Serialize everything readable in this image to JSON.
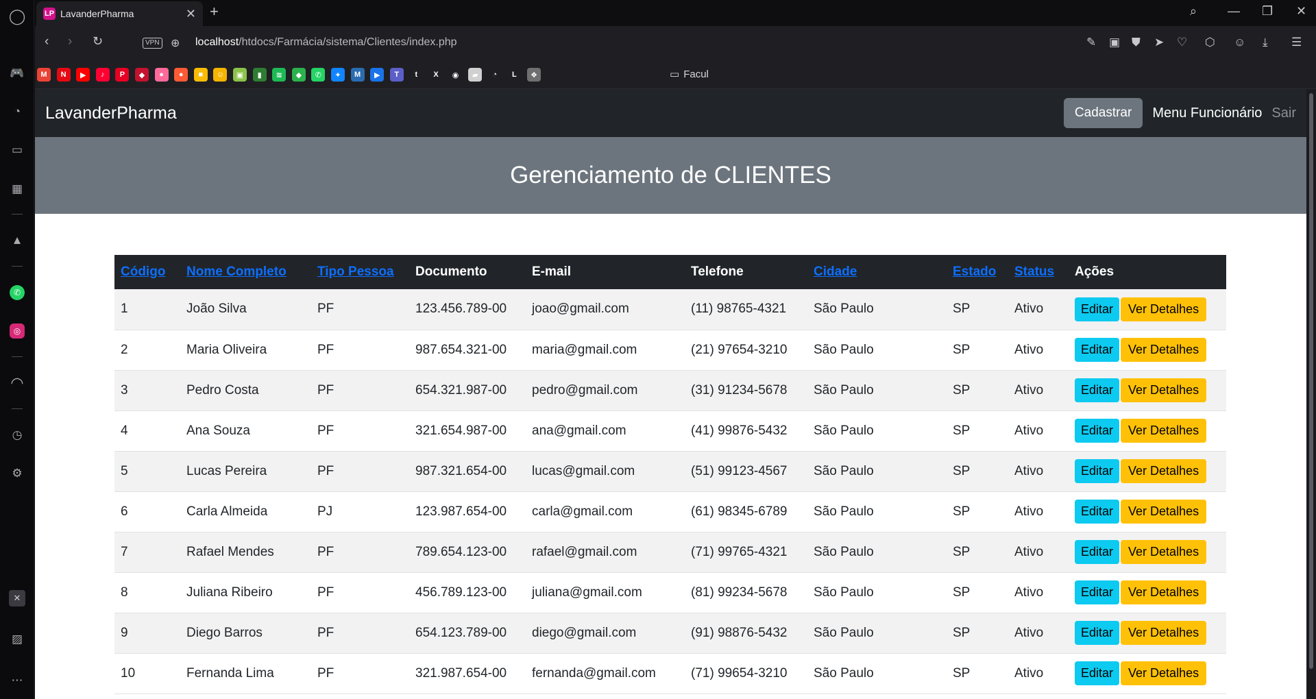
{
  "browser": {
    "tab_title": "LavanderPharma",
    "tab_favicon": "LP",
    "new_tab": "+",
    "vpn_label": "VPN",
    "url_host": "localhost",
    "url_path": "/htdocs/Farmácia/sistema/Clientes/index.php",
    "bookmark_folder": "Facul",
    "bookmarks": [
      {
        "icon": "gmail-icon",
        "glyph": "M",
        "color": "#ea4335"
      },
      {
        "icon": "netflix-icon",
        "glyph": "N",
        "color": "#e50914"
      },
      {
        "icon": "youtube-icon",
        "glyph": "▶",
        "color": "#ff0000"
      },
      {
        "icon": "youtube-music-icon",
        "glyph": "♪",
        "color": "#ff0033"
      },
      {
        "icon": "pinterest-icon",
        "glyph": "P",
        "color": "#e60023"
      },
      {
        "icon": "app-icon",
        "glyph": "◆",
        "color": "#c4122f"
      },
      {
        "icon": "app-icon",
        "glyph": "●",
        "color": "#ff6a9a"
      },
      {
        "icon": "app-icon",
        "glyph": "●",
        "color": "#ff5a36"
      },
      {
        "icon": "keep-icon",
        "glyph": "■",
        "color": "#fbbc04"
      },
      {
        "icon": "app-icon",
        "glyph": "☺",
        "color": "#f4b400"
      },
      {
        "icon": "app-icon",
        "glyph": "▣",
        "color": "#8bc34a"
      },
      {
        "icon": "app-icon",
        "glyph": "▮",
        "color": "#2e7d32"
      },
      {
        "icon": "spotify-icon",
        "glyph": "≋",
        "color": "#1db954"
      },
      {
        "icon": "feedly-icon",
        "glyph": "◆",
        "color": "#2bb24c"
      },
      {
        "icon": "whatsapp-icon",
        "glyph": "✆",
        "color": "#25d366"
      },
      {
        "icon": "bluesky-icon",
        "glyph": "✦",
        "color": "#1185fe"
      },
      {
        "icon": "app-icon",
        "glyph": "M",
        "color": "#2b6cb0"
      },
      {
        "icon": "app-icon",
        "glyph": "▶",
        "color": "#1a73e8"
      },
      {
        "icon": "teams-icon",
        "glyph": "T",
        "color": "#5b5fc7"
      },
      {
        "icon": "tumblr-icon",
        "glyph": "t",
        "color": "#1f1f23"
      },
      {
        "icon": "x-icon",
        "glyph": "X",
        "color": "#1f1f23"
      },
      {
        "icon": "github-icon",
        "glyph": "◉",
        "color": "#1f1f23"
      },
      {
        "icon": "app-icon",
        "glyph": "▰",
        "color": "#d0d0d0"
      },
      {
        "icon": "speedtest-icon",
        "glyph": "◔",
        "color": "#1f1f23"
      },
      {
        "icon": "app-icon",
        "glyph": "L",
        "color": "#1f1f23"
      },
      {
        "icon": "app-icon",
        "glyph": "❖",
        "color": "#6f6f6f"
      }
    ]
  },
  "page": {
    "brand": "LavanderPharma",
    "nav": {
      "cadastrar": "Cadastrar",
      "menu_funcionario": "Menu Funcionário",
      "sair": "Sair"
    },
    "title": "Gerenciamento de CLIENTES"
  },
  "table": {
    "headers": [
      "Código",
      "Nome Completo",
      "Tipo Pessoa",
      "Documento",
      "E-mail",
      "Telefone",
      "Cidade",
      "Estado",
      "Status",
      "Ações"
    ],
    "edit_label": "Editar",
    "details_label": "Ver Detalhes",
    "rows": [
      [
        "1",
        "João Silva",
        "PF",
        "123.456.789-00",
        "joao@gmail.com",
        "(11) 98765-4321",
        "São Paulo",
        "SP",
        "Ativo"
      ],
      [
        "2",
        "Maria Oliveira",
        "PF",
        "987.654.321-00",
        "maria@gmail.com",
        "(21) 97654-3210",
        "São Paulo",
        "SP",
        "Ativo"
      ],
      [
        "3",
        "Pedro Costa",
        "PF",
        "654.321.987-00",
        "pedro@gmail.com",
        "(31) 91234-5678",
        "São Paulo",
        "SP",
        "Ativo"
      ],
      [
        "4",
        "Ana Souza",
        "PF",
        "321.654.987-00",
        "ana@gmail.com",
        "(41) 99876-5432",
        "São Paulo",
        "SP",
        "Ativo"
      ],
      [
        "5",
        "Lucas Pereira",
        "PF",
        "987.321.654-00",
        "lucas@gmail.com",
        "(51) 99123-4567",
        "São Paulo",
        "SP",
        "Ativo"
      ],
      [
        "6",
        "Carla Almeida",
        "PJ",
        "123.987.654-00",
        "carla@gmail.com",
        "(61) 98345-6789",
        "São Paulo",
        "SP",
        "Ativo"
      ],
      [
        "7",
        "Rafael Mendes",
        "PF",
        "789.654.123-00",
        "rafael@gmail.com",
        "(71) 99765-4321",
        "São Paulo",
        "SP",
        "Ativo"
      ],
      [
        "8",
        "Juliana Ribeiro",
        "PF",
        "456.789.123-00",
        "juliana@gmail.com",
        "(81) 99234-5678",
        "São Paulo",
        "SP",
        "Ativo"
      ],
      [
        "9",
        "Diego Barros",
        "PF",
        "654.123.789-00",
        "diego@gmail.com",
        "(91) 98876-5432",
        "São Paulo",
        "SP",
        "Ativo"
      ],
      [
        "10",
        "Fernanda Lima",
        "PF",
        "321.987.654-00",
        "fernanda@gmail.com",
        "(71) 99654-3210",
        "São Paulo",
        "SP",
        "Ativo"
      ]
    ]
  }
}
